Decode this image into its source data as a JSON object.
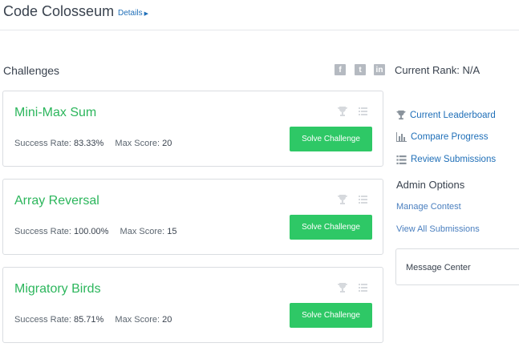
{
  "header": {
    "title": "Code Colosseum",
    "details_label": "Details"
  },
  "challenges": {
    "heading": "Challenges",
    "social": {
      "facebook_glyph": "f",
      "twitter_glyph": "t",
      "linkedin_glyph": "in"
    },
    "success_label": "Success Rate:",
    "max_score_label": "Max Score:",
    "solve_label": "Solve Challenge",
    "items": [
      {
        "title": "Mini-Max Sum",
        "success_rate": "83.33%",
        "max_score": "20"
      },
      {
        "title": "Array Reversal",
        "success_rate": "100.00%",
        "max_score": "15"
      },
      {
        "title": "Migratory Birds",
        "success_rate": "85.71%",
        "max_score": "20"
      }
    ]
  },
  "sidebar": {
    "rank": "Current Rank: N/A",
    "links": [
      {
        "label": "Current Leaderboard",
        "icon": "trophy-icon"
      },
      {
        "label": "Compare Progress",
        "icon": "bar-chart-icon"
      },
      {
        "label": "Review Submissions",
        "icon": "list-icon"
      }
    ],
    "admin_heading": "Admin Options",
    "admin_links": [
      {
        "label": "Manage Contest"
      },
      {
        "label": "View All Submissions"
      }
    ],
    "message_center": "Message Center"
  },
  "colors": {
    "accent_green": "#2ec866",
    "title_green": "#2cb65c",
    "link_blue": "#1f6fb8",
    "icon_gray": "#b5bac1"
  }
}
